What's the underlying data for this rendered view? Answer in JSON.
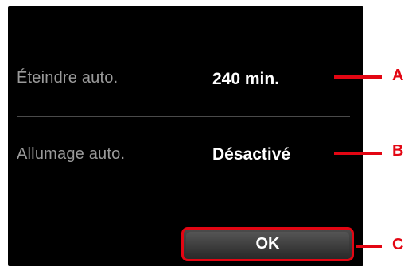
{
  "settings": {
    "auto_off_label": "Éteindre auto.",
    "auto_off_value": "240 min.",
    "auto_on_label": "Allumage auto.",
    "auto_on_value": "Désactivé"
  },
  "buttons": {
    "ok_label": "OK"
  },
  "callouts": [
    "A",
    "B",
    "C"
  ],
  "colors": {
    "screen_bg": "#000000",
    "label": "#9a9a9a",
    "value": "#ffffff",
    "callout": "#e30613"
  }
}
